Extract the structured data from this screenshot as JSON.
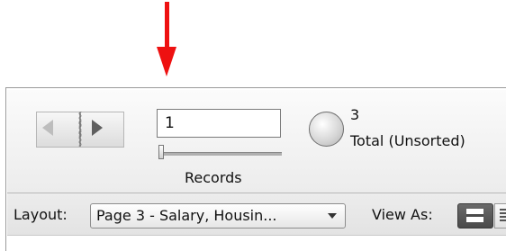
{
  "annotation": {
    "arrow_color": "#ee1111"
  },
  "navigation": {
    "book_icon": "book-icon",
    "prev_icon": "left-triangle-icon",
    "next_icon": "right-triangle-icon"
  },
  "record": {
    "current_value": "1",
    "records_label": "Records",
    "count": "3",
    "total_label": "Total (Unsorted)"
  },
  "layout": {
    "label": "Layout:",
    "selected": "Page 3 - Salary, Housin...",
    "view_as_label": "View As:",
    "view_modes": [
      "form-view-icon",
      "list-view-icon"
    ]
  }
}
